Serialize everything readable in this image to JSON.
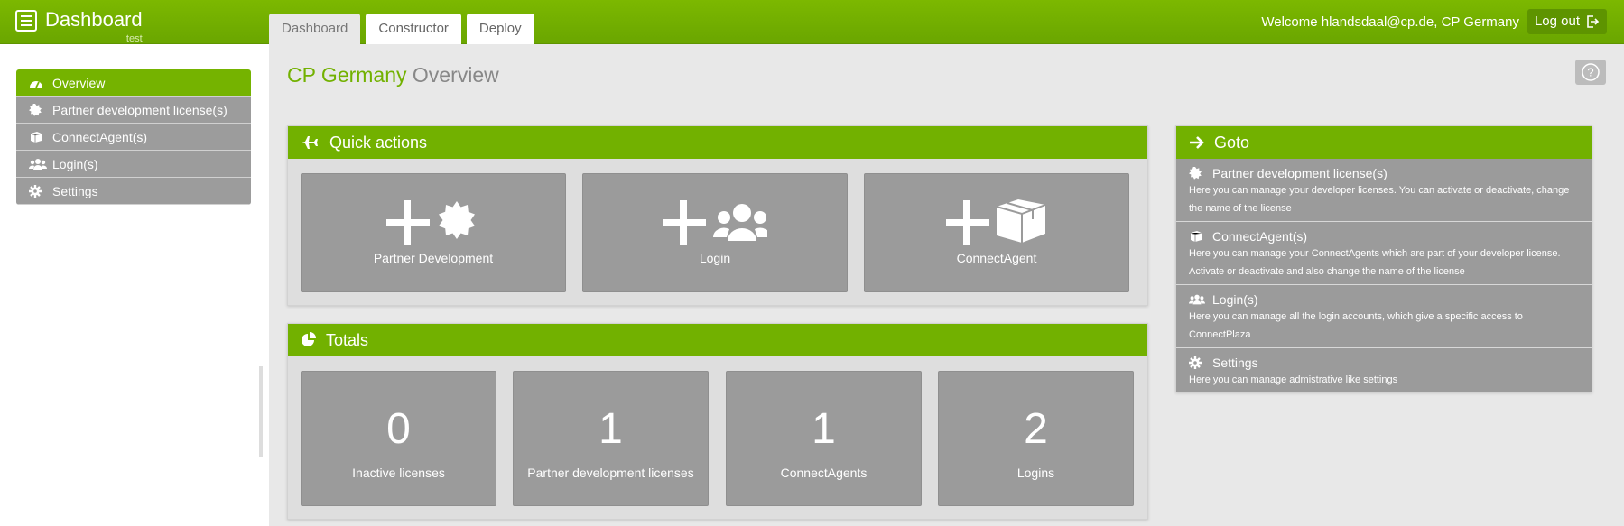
{
  "header": {
    "title": "Dashboard",
    "subtitle": "test",
    "tabs": [
      {
        "label": "Dashboard",
        "active": true
      },
      {
        "label": "Constructor",
        "active": false
      },
      {
        "label": "Deploy",
        "active": false
      }
    ],
    "welcome": "Welcome hlandsdaal@cp.de, CP Germany",
    "logout_label": "Log out"
  },
  "sidebar": {
    "items": [
      {
        "label": "Overview",
        "icon": "dashboard-icon",
        "active": true
      },
      {
        "label": "Partner development license(s)",
        "icon": "certificate-icon",
        "active": false
      },
      {
        "label": "ConnectAgent(s)",
        "icon": "cube-icon",
        "active": false
      },
      {
        "label": "Login(s)",
        "icon": "users-icon",
        "active": false
      },
      {
        "label": "Settings",
        "icon": "gear-icon",
        "active": false
      }
    ]
  },
  "page": {
    "title_company": "CP Germany",
    "title_rest": "Overview",
    "help_label": "?"
  },
  "quick_actions": {
    "title": "Quick actions",
    "tiles": [
      {
        "label": "Partner Development",
        "icon": "add-certificate-icon"
      },
      {
        "label": "Login",
        "icon": "add-users-icon"
      },
      {
        "label": "ConnectAgent",
        "icon": "add-cube-icon"
      }
    ]
  },
  "totals": {
    "title": "Totals",
    "tiles": [
      {
        "value": "0",
        "label": "Inactive licenses"
      },
      {
        "value": "1",
        "label": "Partner development licenses"
      },
      {
        "value": "1",
        "label": "ConnectAgents"
      },
      {
        "value": "2",
        "label": "Logins"
      }
    ]
  },
  "goto": {
    "title": "Goto",
    "items": [
      {
        "title": "Partner development license(s)",
        "icon": "certificate-icon",
        "desc": "Here you can manage your developer licenses. You can activate or deactivate, change the name of the license"
      },
      {
        "title": "ConnectAgent(s)",
        "icon": "cube-icon",
        "desc": "Here you can manage your ConnectAgents which are part of your developer license. Activate or deactivate and also change the name of the license"
      },
      {
        "title": "Login(s)",
        "icon": "users-icon",
        "desc": "Here you can manage all the login accounts, which give a specific access to ConnectPlaza"
      },
      {
        "title": "Settings",
        "icon": "gear-icon",
        "desc": "Here you can manage admistrative like settings"
      }
    ]
  },
  "colors": {
    "brand_green": "#72b100",
    "tile_gray": "#9b9b9b",
    "background": "#e8e8e8"
  }
}
